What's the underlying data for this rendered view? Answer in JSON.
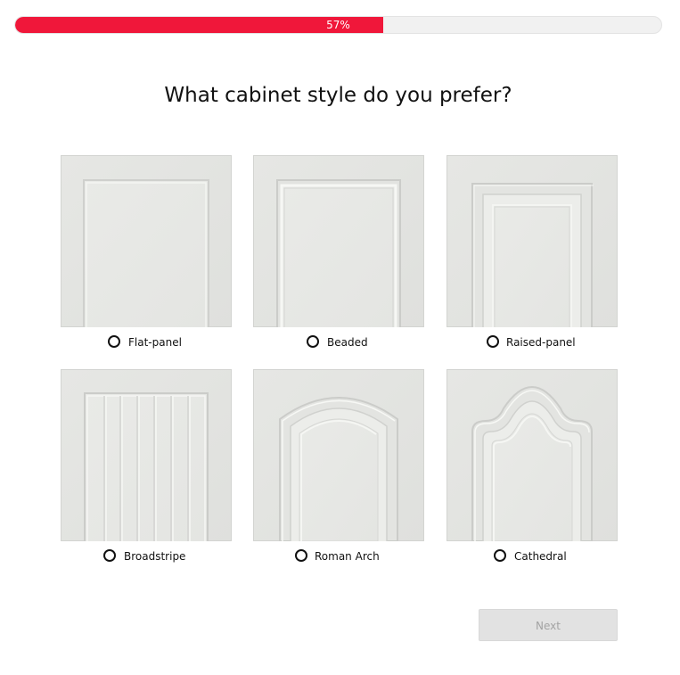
{
  "progress": {
    "percent": 57,
    "label": "57%",
    "fill_color": "#f0173a",
    "track_color": "#f1f1f1"
  },
  "question": {
    "title": "What cabinet style do you prefer?"
  },
  "options": [
    {
      "label": "Flat-panel",
      "image": "flat-panel-door",
      "selected": false
    },
    {
      "label": "Beaded",
      "image": "beaded-door",
      "selected": false
    },
    {
      "label": "Raised-panel",
      "image": "raised-panel-door",
      "selected": false
    },
    {
      "label": "Broadstripe",
      "image": "broadstripe-door",
      "selected": false
    },
    {
      "label": "Roman Arch",
      "image": "roman-arch-door",
      "selected": false
    },
    {
      "label": "Cathedral",
      "image": "cathedral-door",
      "selected": false
    }
  ],
  "footer": {
    "next_label": "Next",
    "next_enabled": false
  }
}
